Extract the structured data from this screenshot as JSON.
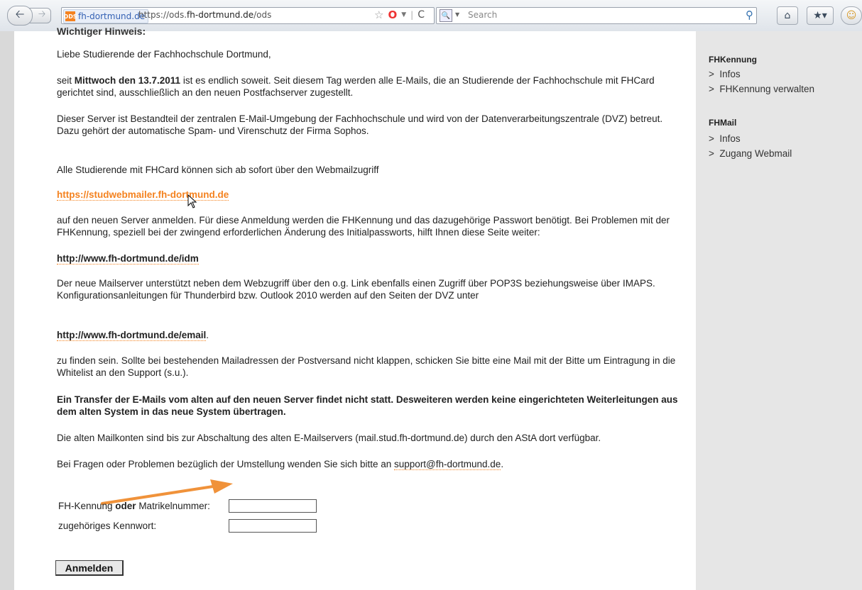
{
  "browser": {
    "site_name": "fh-dortmund.de",
    "site_icon": "ODS",
    "url_prefix": "https://ods.",
    "url_domain": "fh-dortmund.de",
    "url_path": "/ods",
    "search_placeholder": "Search"
  },
  "main": {
    "heading_cut": "Wichtiger Hinweis:",
    "greeting": "Liebe Studierende der Fachhochschule Dortmund,",
    "p1_pre": "seit ",
    "p1_bold": "Mittwoch den 13.7.2011",
    "p1_post": " ist es endlich soweit. Seit diesem Tag werden alle E-Mails, die an Studierende der Fachhochschule mit FHCard gerichtet sind, ausschließlich an den neuen Postfachserver zugestellt.",
    "p2_a": "Dieser Server ist Bestandteil der zentralen E-Mail-Umgebung der Fachhochschule und wird von der Datenverarbeitungszentrale (DVZ) betreut.",
    "p2_b": "Dazu gehört der automatische Spam- und Virenschutz der Firma Sophos.",
    "p3": "Alle Studierende mit FHCard können sich ab sofort über den Webmailzugriff",
    "link_webmail": "https://studwebmailer.fh-dortmund.de",
    "p4": "auf den neuen Server anmelden. Für diese Anmeldung werden die FHKennung und das dazugehörige Passwort benötigt. Bei Problemen mit der FHKennung, speziell bei der zwingend erforderlichen Änderung des Initialpassworts, hilft Ihnen diese Seite weiter:",
    "link_idm": "http://www.fh-dortmund.de/idm",
    "p5_a": "Der neue Mailserver unterstützt neben dem Webzugriff über den o.g. Link ebenfalls einen Zugriff über POP3S beziehungsweise über IMAPS.",
    "p5_b": "Konfigurationsanleitungen für Thunderbird bzw. Outlook 2010 werden auf den Seiten der DVZ unter",
    "link_email": "http://www.fh-dortmund.de/email",
    "link_email_suffix": ".",
    "p6": "zu finden sein. Sollte bei bestehenden Mailadressen der Postversand nicht klappen, schicken Sie bitte eine Mail mit der Bitte um Eintragung in die Whitelist an den Support (s.u.).",
    "p7_bold": "Ein Transfer der E-Mails vom alten auf den neuen Server findet nicht statt. Desweiteren werden keine eingerichteten Weiterleitungen aus dem alten System in das neue System übertragen.",
    "p8": "Die alten Mailkonten sind bis zur Abschaltung des alten E-Mailservers (mail.stud.fh-dortmund.de) durch den AStA dort verfügbar.",
    "p9_pre": "Bei Fragen oder Problemen bezüglich der Umstellung wenden Sie sich bitte an ",
    "p9_mail": "support@fh-dortmund.de",
    "p9_post": "."
  },
  "form": {
    "user_label_a": "FH-Kennung ",
    "user_label_bold": "oder",
    "user_label_b": " Matrikelnummer:",
    "user_value": "",
    "password_label": "zugehöriges Kennwort:",
    "password_value": "",
    "submit_label": "Anmelden"
  },
  "sidebar": {
    "section1_title": "FHKennung",
    "section1_items": [
      "Infos",
      "FHKennung verwalten"
    ],
    "section2_title": "FHMail",
    "section2_items": [
      "Infos",
      "Zugang Webmail"
    ],
    "bullet": ">"
  },
  "colors": {
    "link_orange": "#f4821f",
    "arrow": "#f0923a"
  }
}
